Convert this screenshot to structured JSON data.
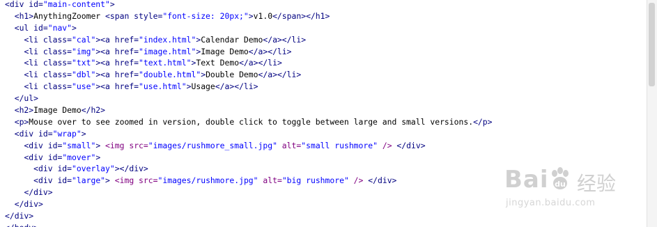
{
  "code_lines": [
    "<div id=\"main-content\">",
    "  <h1>AnythingZoomer <span style=\"font-size: 20px;\">v1.0</span></h1>",
    "  <ul id=\"nav\">",
    "    <li class=\"cal\"><a href=\"index.html\">Calendar Demo</a></li>",
    "    <li class=\"img\"><a href=\"image.html\">Image Demo</a></li>",
    "    <li class=\"txt\"><a href=\"text.html\">Text Demo</a></li>",
    "    <li class=\"dbl\"><a href=\"double.html\">Double Demo</a></li>",
    "    <li class=\"use\"><a href=\"use.html\">Usage</a></li>",
    "  </ul>",
    "  <h2>Image Demo</h2>",
    "  <p>Mouse over to see zoomed in version, double click to toggle between large and small versions.</p>",
    "  <div id=\"wrap\">",
    "    <div id=\"small\"> <img src=\"images/rushmore_small.jpg\" alt=\"small rushmore\" /> </div>",
    "    <div id=\"mover\">",
    "      <div id=\"overlay\"></div>",
    "      <div id=\"large\"> <img src=\"images/rushmore.jpg\" alt=\"big rushmore\" /> </div>",
    "    </div>",
    "  </div>",
    "</div>",
    "</body>"
  ],
  "watermark": {
    "logo_text": "Bai",
    "logo_text_tail": "经验",
    "url": "jingyan.baidu.com"
  },
  "colors": {
    "tag": "#000080",
    "attr_value": "#0000ff",
    "img_tag": "#800080",
    "text": "#000000",
    "watermark": "#c8c8c8"
  }
}
